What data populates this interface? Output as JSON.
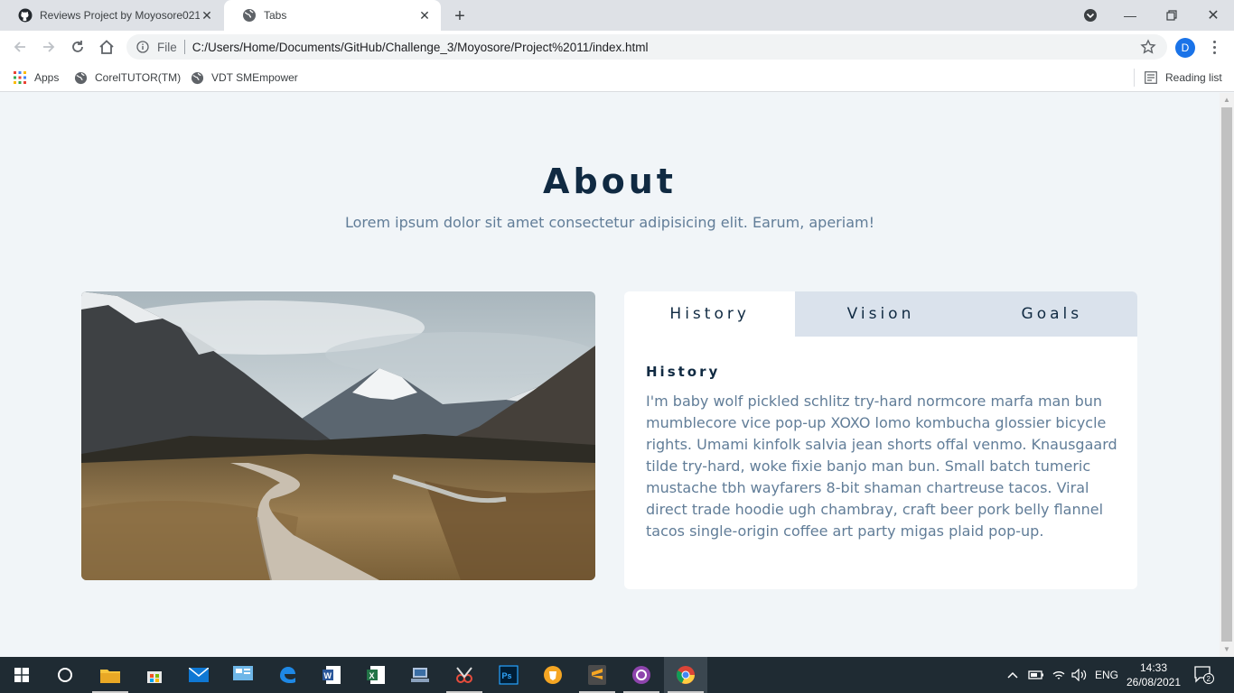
{
  "browser": {
    "tabs": [
      {
        "title": "Reviews Project by Moyosore021",
        "active": false
      },
      {
        "title": "Tabs",
        "active": true
      }
    ],
    "address": {
      "scheme": "File",
      "url": "C:/Users/Home/Documents/GitHub/Challenge_3/Moyosore/Project%2011/index.html"
    },
    "profile_initial": "D",
    "bookmarks": [
      {
        "label": "Apps",
        "icon": "apps-grid-icon"
      },
      {
        "label": "CorelTUTOR(TM)",
        "icon": "globe-icon"
      },
      {
        "label": "VDT SMEmpower",
        "icon": "globe-icon"
      }
    ],
    "reading_list": "Reading list"
  },
  "page": {
    "title": "About",
    "subtitle": "Lorem ipsum dolor sit amet consectetur adipisicing elit. Earum, aperiam!",
    "tabs": [
      {
        "label": "History",
        "active": true
      },
      {
        "label": "Vision",
        "active": false
      },
      {
        "label": "Goals",
        "active": false
      }
    ],
    "content": {
      "heading": "History",
      "text": "I'm baby wolf pickled schlitz try-hard normcore marfa man bun mumblecore vice pop-up XOXO lomo kombucha glossier bicycle rights. Umami kinfolk salvia jean shorts offal venmo. Knausgaard tilde try-hard, woke fixie banjo man bun. Small batch tumeric mustache tbh wayfarers 8-bit shaman chartreuse tacos. Viral direct trade hoodie ugh chambray, craft beer pork belly flannel tacos single-origin coffee art party migas plaid pop-up."
    }
  },
  "taskbar": {
    "language": "ENG",
    "time": "14:33",
    "date": "26/08/2021",
    "notifications": "2"
  },
  "colors": {
    "primary_text": "#102a42",
    "secondary_text": "#617d98",
    "page_bg": "#f1f5f8",
    "tab_inactive_bg": "#dae2ec"
  }
}
